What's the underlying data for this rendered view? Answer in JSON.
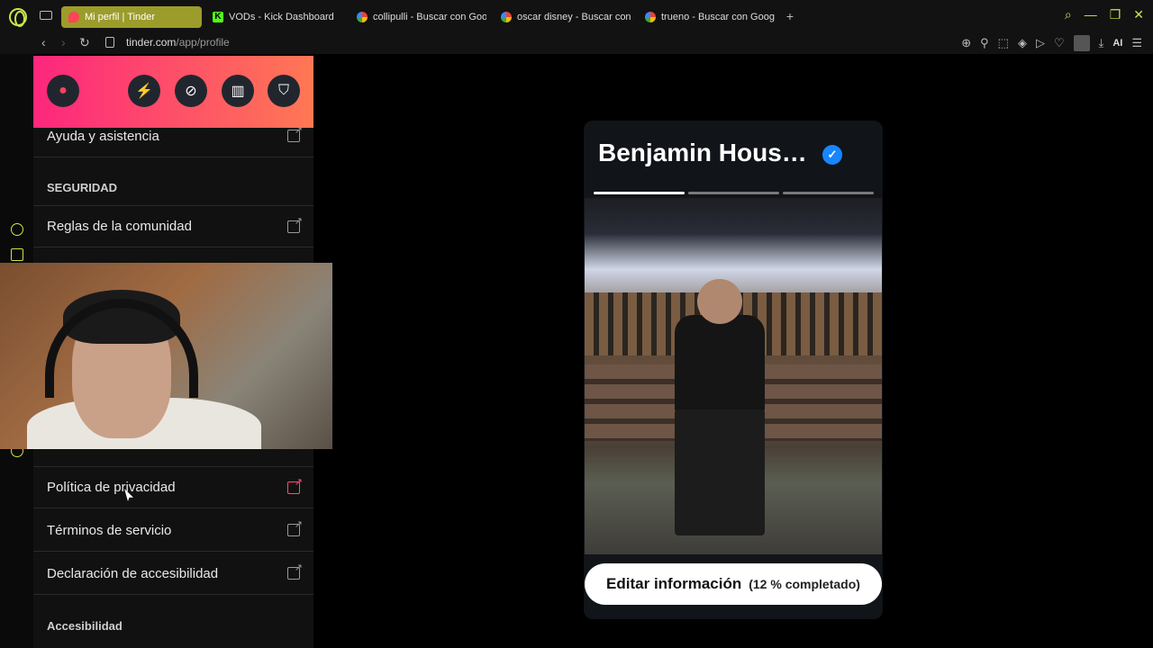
{
  "browser": {
    "tabs": [
      {
        "label": "Mi perfil | Tinder",
        "active": true,
        "favicon": "tinder"
      },
      {
        "label": "VODs - Kick Dashboard",
        "active": false,
        "favicon": "kick"
      },
      {
        "label": "collipulli - Buscar con Goo",
        "active": false,
        "favicon": "google"
      },
      {
        "label": "oscar disney - Buscar con",
        "active": false,
        "favicon": "google"
      },
      {
        "label": "trueno - Buscar con Googl",
        "active": false,
        "favicon": "google"
      }
    ],
    "url_host": "tinder.com",
    "url_path": "/app/profile",
    "ai_label": "AI"
  },
  "sidebar": {
    "help_label": "Ayuda y asistencia",
    "security_section": "SEGURIDAD",
    "community_rules": "Reglas de la comunidad",
    "privacy_policy": "Política de privacidad",
    "terms": "Términos de servicio",
    "accessibility_statement": "Declaración de accesibilidad",
    "accessibility_section": "Accesibilidad"
  },
  "profile": {
    "name": "Benjamin Hous…",
    "verified_icon": "verified-check",
    "photo_count": 3,
    "active_photo": 1,
    "edit_label": "Editar información",
    "completion_label": "(12 % completado)"
  },
  "colors": {
    "accent": "#c8e64b",
    "tinder_gradient_start": "#fd267d",
    "tinder_gradient_end": "#ff7854",
    "verified": "#1786ff"
  }
}
